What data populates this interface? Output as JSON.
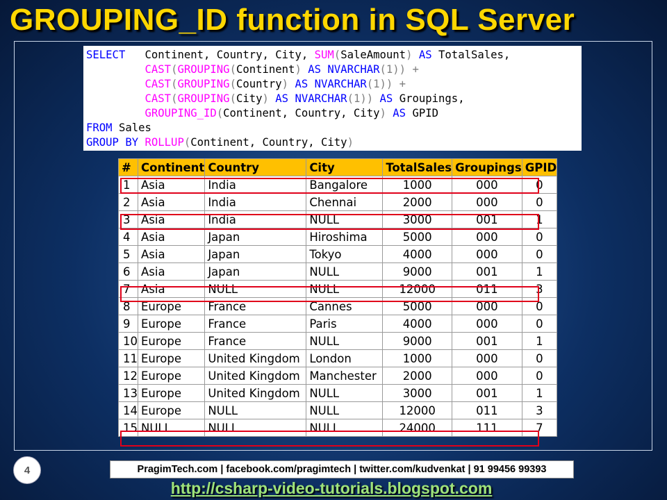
{
  "slide": {
    "title": "GROUPING_ID function in SQL Server",
    "page_number": "4"
  },
  "code": {
    "l1_select": "SELECT",
    "l1_cols": "Continent, Country, City, ",
    "l1_sum": "SUM",
    "l1_open": "(",
    "l1_arg": "SaleAmount",
    "l1_close": ")",
    "l1_as": "AS",
    "l1_alias": "TotalSales,",
    "l2_cast": "CAST",
    "l2_open1": "(",
    "l2_grouping": "GROUPING",
    "l2_open2": "(",
    "l2_arg": "Continent",
    "l2_close1": ")",
    "l2_as": "AS",
    "l2_type": "NVARCHAR",
    "l2_tail": "(1)) +",
    "l3_cast": "CAST",
    "l3_open1": "(",
    "l3_grouping": "GROUPING",
    "l3_open2": "(",
    "l3_arg": "Country",
    "l3_close1": ")",
    "l3_as": "AS",
    "l3_type": "NVARCHAR",
    "l3_tail": "(1)) +",
    "l4_cast": "CAST",
    "l4_open1": "(",
    "l4_grouping": "GROUPING",
    "l4_open2": "(",
    "l4_arg": "City",
    "l4_close1": ")",
    "l4_as": "AS",
    "l4_type": "NVARCHAR",
    "l4_tail": "(1))",
    "l4_as2": "AS",
    "l4_alias": "Groupings,",
    "l5_fn": "GROUPING_ID",
    "l5_open": "(",
    "l5_args": "Continent, Country, City",
    "l5_close": ")",
    "l5_as": "AS",
    "l5_alias": "GPID",
    "l6_from": "FROM",
    "l6_table": "Sales",
    "l7_groupby": "GROUP BY",
    "l7_rollup": "ROLLUP",
    "l7_open": "(",
    "l7_args": "Continent, Country, City",
    "l7_close": ")"
  },
  "table": {
    "headers": [
      "#",
      "Continent",
      "Country",
      "City",
      "TotalSales",
      "Groupings",
      "GPID"
    ],
    "rows": [
      [
        "1",
        "Asia",
        "India",
        "Bangalore",
        "1000",
        "000",
        "0"
      ],
      [
        "2",
        "Asia",
        "India",
        "Chennai",
        "2000",
        "000",
        "0"
      ],
      [
        "3",
        "Asia",
        "India",
        "NULL",
        "3000",
        "001",
        "1"
      ],
      [
        "4",
        "Asia",
        "Japan",
        "Hiroshima",
        "5000",
        "000",
        "0"
      ],
      [
        "5",
        "Asia",
        "Japan",
        "Tokyo",
        "4000",
        "000",
        "0"
      ],
      [
        "6",
        "Asia",
        "Japan",
        "NULL",
        "9000",
        "001",
        "1"
      ],
      [
        "7",
        "Asia",
        "NULL",
        "NULL",
        "12000",
        "011",
        "3"
      ],
      [
        "8",
        "Europe",
        "France",
        "Cannes",
        "5000",
        "000",
        "0"
      ],
      [
        "9",
        "Europe",
        "France",
        "Paris",
        "4000",
        "000",
        "0"
      ],
      [
        "10",
        "Europe",
        "France",
        "NULL",
        "9000",
        "001",
        "1"
      ],
      [
        "11",
        "Europe",
        "United Kingdom",
        "London",
        "1000",
        "000",
        "0"
      ],
      [
        "12",
        "Europe",
        "United Kingdom",
        "Manchester",
        "2000",
        "000",
        "0"
      ],
      [
        "13",
        "Europe",
        "United Kingdom",
        "NULL",
        "3000",
        "001",
        "1"
      ],
      [
        "14",
        "Europe",
        "NULL",
        "NULL",
        "12000",
        "011",
        "3"
      ],
      [
        "15",
        "NULL",
        "NULL",
        "NULL",
        "24000",
        "111",
        "7"
      ]
    ],
    "highlight_color": "#e0001a",
    "header_color": "#ffc000"
  },
  "footer": {
    "contact": "PragimTech.com | facebook.com/pragimtech | twitter.com/kudvenkat | 91 99456 99393",
    "url": "http://csharp-video-tutorials.blogspot.com"
  }
}
